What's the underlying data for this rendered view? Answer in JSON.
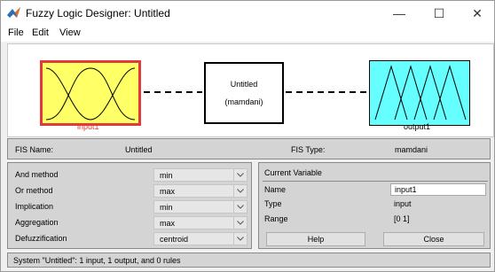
{
  "window": {
    "title": "Fuzzy Logic Designer: Untitled",
    "minimize_glyph": "—",
    "maximize_glyph": "☐",
    "close_glyph": "✕"
  },
  "menu": [
    "File",
    "Edit",
    "View"
  ],
  "diagram": {
    "input_label": "input1",
    "output_label": "output1",
    "system_name": "Untitled",
    "system_type": "(mamdani)",
    "colors": {
      "input_fill": "#ffff66",
      "input_border": "#e03a3a",
      "output_fill": "#66ffff"
    }
  },
  "fis": {
    "name_label": "FIS Name:",
    "name_value": "Untitled",
    "type_label": "FIS Type:",
    "type_value": "mamdani"
  },
  "methods": [
    {
      "label": "And method",
      "value": "min"
    },
    {
      "label": "Or method",
      "value": "max"
    },
    {
      "label": "Implication",
      "value": "min"
    },
    {
      "label": "Aggregation",
      "value": "max"
    },
    {
      "label": "Defuzzification",
      "value": "centroid"
    }
  ],
  "current_variable": {
    "heading": "Current Variable",
    "name_label": "Name",
    "name_value": "input1",
    "type_label": "Type",
    "type_value": "input",
    "range_label": "Range",
    "range_value": "[0 1]"
  },
  "buttons": {
    "help": "Help",
    "close": "Close"
  },
  "status": "System \"Untitled\": 1 input, 1 output, and 0 rules"
}
